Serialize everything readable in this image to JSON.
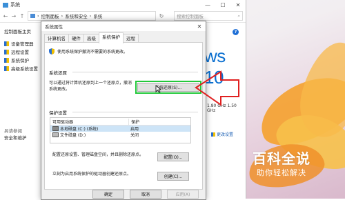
{
  "system_window": {
    "title": "系统",
    "controls": [
      "—",
      "☐",
      "✕"
    ],
    "breadcrumb": [
      "控制面板",
      "系统和安全",
      "系统"
    ],
    "search_placeholder": "搜索控制面板",
    "left_nav": {
      "home": "控制面板主页",
      "items": [
        "设备管理器",
        "远程设置",
        "系统保护",
        "高级系统设置"
      ],
      "see_also_title": "另请参阅",
      "see_also_items": [
        "安全和维护"
      ]
    },
    "windows_logo_text": "ws 10",
    "cpu_speed": "1.80 GHz   1.50 GHz",
    "change_settings": "更改设置"
  },
  "dialog": {
    "title": "系统属性",
    "close": "✕",
    "tabs": [
      "计算机名",
      "硬件",
      "高级",
      "系统保护",
      "远程"
    ],
    "active_tab": "系统保护",
    "intro": "使用系统保护撤消不需要的系统更改。",
    "restore": {
      "heading": "系统还原",
      "description_line1": "可以通过将计算机还原到上一个还原点，撤消",
      "description_line2": "系统更改。",
      "button": "系统还原(S)..."
    },
    "protection": {
      "heading": "保护设置",
      "columns": [
        "可用驱动器",
        "保护"
      ],
      "rows": [
        {
          "drive": "本地磁盘 (C:) (系统)",
          "status": "启用"
        },
        {
          "drive": "文件磁盘 (D:)",
          "status": "关闭"
        }
      ],
      "configure_text": "配置还原设置、管理磁盘空间，并且删除还原点。",
      "configure_button": "配置(O)...",
      "create_text": "立刻为启用系统保护的驱动器创建还原点。",
      "create_button": "创建(C)..."
    },
    "footer_buttons": [
      "确定",
      "取消",
      "应用(A)"
    ]
  },
  "watermark": {
    "title": "百科全说",
    "subtitle": "助你轻松解决"
  },
  "colors": {
    "highlight": "#22c83a",
    "arrow": "#e02020",
    "accent": "#0a6fd0"
  }
}
